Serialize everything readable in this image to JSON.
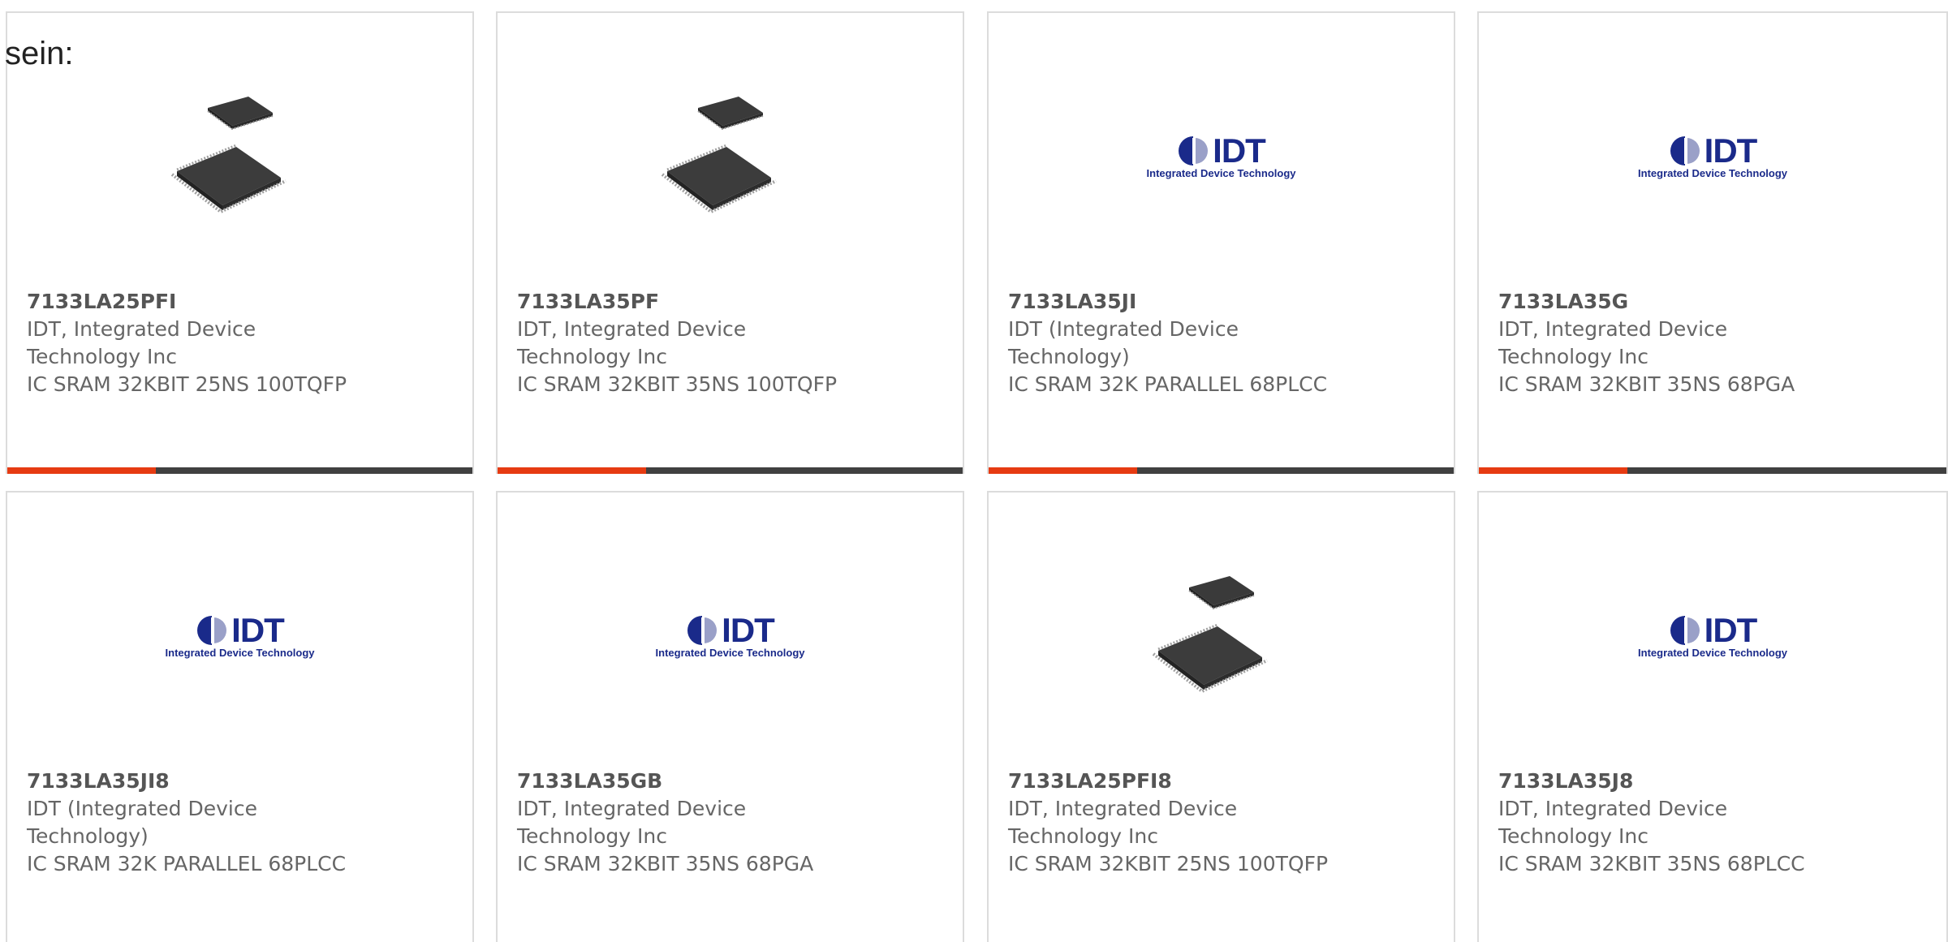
{
  "intro_text": "sein:",
  "colors": {
    "accent": "#e63b12",
    "bar_dark": "#404040",
    "card_border": "#dcdcdc",
    "logo_blue": "#1a2a8a"
  },
  "logo": {
    "word": "IDT",
    "tagline": "Integrated Device Technology"
  },
  "products": [
    {
      "part": "7133LA25PFI",
      "manufacturer": "IDT, Integrated Device Technology Inc",
      "description": "IC SRAM 32KBIT 25NS 100TQFP",
      "image": "chip-photo"
    },
    {
      "part": "7133LA35PF",
      "manufacturer": "IDT, Integrated Device Technology Inc",
      "description": "IC SRAM 32KBIT 35NS 100TQFP",
      "image": "chip-photo"
    },
    {
      "part": "7133LA35JI",
      "manufacturer": "IDT (Integrated Device Technology)",
      "description": "IC SRAM 32K PARALLEL 68PLCC",
      "image": "idt-logo"
    },
    {
      "part": "7133LA35G",
      "manufacturer": "IDT, Integrated Device Technology Inc",
      "description": "IC SRAM 32KBIT 35NS 68PGA",
      "image": "idt-logo"
    },
    {
      "part": "7133LA35JI8",
      "manufacturer": "IDT (Integrated Device Technology)",
      "description": "IC SRAM 32K PARALLEL 68PLCC",
      "image": "idt-logo"
    },
    {
      "part": "7133LA35GB",
      "manufacturer": "IDT, Integrated Device Technology Inc",
      "description": "IC SRAM 32KBIT 35NS 68PGA",
      "image": "idt-logo"
    },
    {
      "part": "7133LA25PFI8",
      "manufacturer": "IDT, Integrated Device Technology Inc",
      "description": "IC SRAM 32KBIT 25NS 100TQFP",
      "image": "chip-photo"
    },
    {
      "part": "7133LA35J8",
      "manufacturer": "IDT, Integrated Device Technology Inc",
      "description": "IC SRAM 32KBIT 35NS 68PLCC",
      "image": "idt-logo"
    }
  ]
}
